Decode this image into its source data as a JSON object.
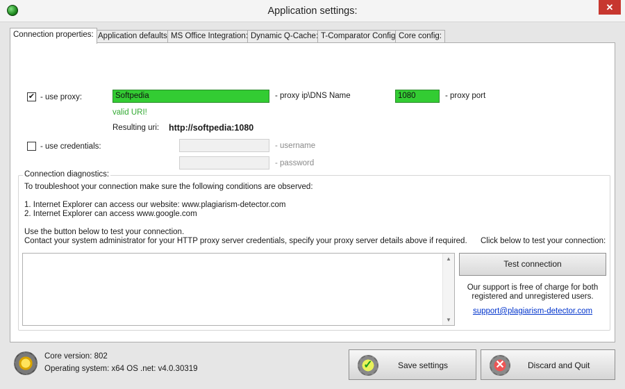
{
  "window": {
    "title": "Application settings:",
    "close_label": "✕"
  },
  "tabs": [
    {
      "label": "Connection properties:"
    },
    {
      "label": "Application defaults:"
    },
    {
      "label": "MS Office Integration:"
    },
    {
      "label": "Dynamic Q-Cache:"
    },
    {
      "label": "T-Comparator Config:"
    },
    {
      "label": "Core config:"
    }
  ],
  "proxy": {
    "checked": true,
    "checkbox_label": "- use proxy:",
    "host_value": "Softpedia",
    "host_label": "- proxy ip\\DNS Name",
    "port_value": "1080",
    "port_label": "- proxy port",
    "valid_text": "valid URI!",
    "resulting_label": "Resulting uri:",
    "resulting_value": "http://softpedia:1080"
  },
  "credentials": {
    "checked": false,
    "checkbox_label": "- use credentials:",
    "username_value": "",
    "username_label": "- username",
    "password_value": "",
    "password_label": "- password"
  },
  "diagnostics": {
    "title": "Connection diagnostics:",
    "intro": "To troubleshoot your connection make sure the following conditions are observed:",
    "line1": "1. Internet Explorer can access our website: www.plagiarism-detector.com",
    "line2": "2. Internet Explorer can access www.google.com",
    "use_button": "Use the button below to test your connection.",
    "contact": "Contact your system administrator for your HTTP proxy server credentials, specify your proxy server details above if required.",
    "click_below": "Click below to test your connection:",
    "log_value": "",
    "test_button": "Test connection",
    "support_line1": "Our support is free of charge for both",
    "support_line2": "registered and unregistered users.",
    "support_email": "support@plagiarism-detector.com"
  },
  "footer": {
    "core_version": "Core version: 802",
    "os": "Operating system: x64 OS .net: v4.0.30319",
    "save_label": "Save settings",
    "discard_label": "Discard and Quit"
  },
  "colors": {
    "valid_field": "#33cc33",
    "link": "#0033cc",
    "close": "#c7372f"
  },
  "icons": [
    "app-icon",
    "gear-icon",
    "check-icon",
    "cancel-icon",
    "scroll-up-icon",
    "scroll-down-icon"
  ]
}
